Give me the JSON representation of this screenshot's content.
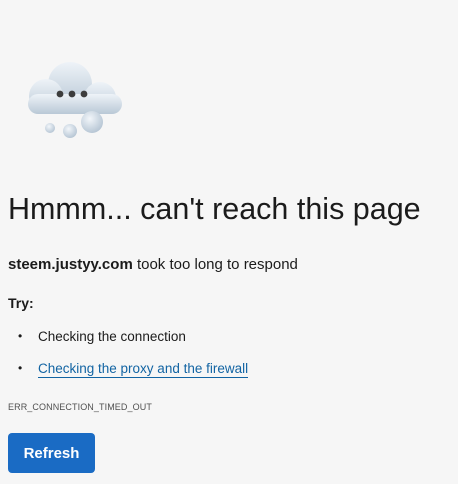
{
  "icon": {
    "name": "cloud-thinking-icon"
  },
  "title": "Hmmm... can't reach this page",
  "message": {
    "host": "steem.justyy.com",
    "rest": " took too long to respond"
  },
  "try_heading": "Try:",
  "suggestions": [
    {
      "bullet": "•",
      "text": "Checking the connection",
      "is_link": false
    },
    {
      "bullet": "•",
      "text": "Checking the proxy and the firewall",
      "is_link": true
    }
  ],
  "error_code": "ERR_CONNECTION_TIMED_OUT",
  "refresh_label": "Refresh",
  "colors": {
    "background": "#f6f6f6",
    "text": "#1b1b1b",
    "link": "#1264a3",
    "button": "#1a6bc4"
  }
}
